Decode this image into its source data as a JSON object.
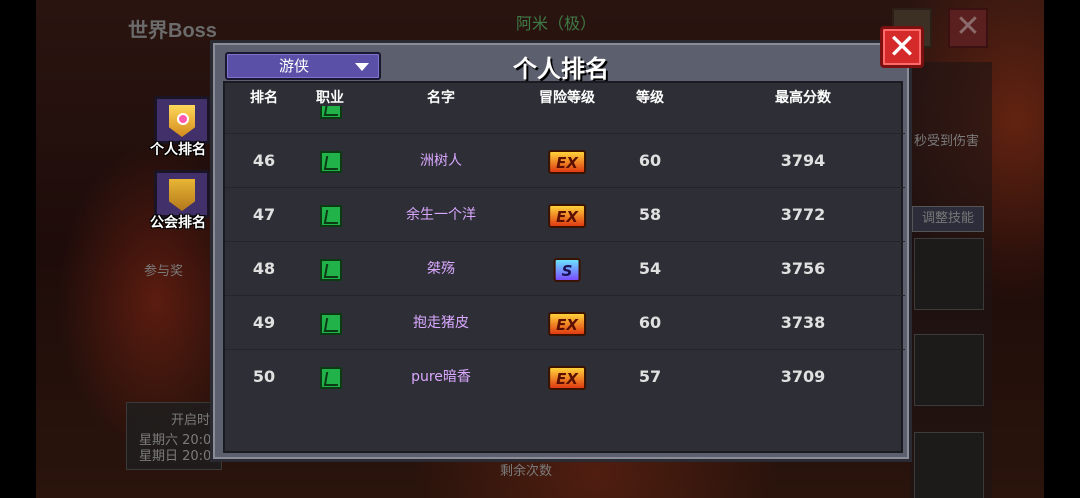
{
  "background": {
    "title": "世界Boss",
    "boss_name": "阿米（极）",
    "close_glyph": "✕",
    "side_damage_text": "秒受到伤害",
    "adjust_skill_label": "调整技能",
    "join_reward_label": "参与奖",
    "open_time_label": "开启时",
    "schedule": [
      "星期六 20:0",
      "星期日 20:0"
    ],
    "remaining_text": "剩余次数"
  },
  "side_tabs": [
    {
      "label": "个人排名",
      "active": true
    },
    {
      "label": "公会排名",
      "active": false
    }
  ],
  "panel": {
    "title": "个人排名",
    "class_filter": "游侠",
    "close_glyph": "✕",
    "columns": [
      "排名",
      "职业",
      "名字",
      "冒险等级",
      "等级",
      "最高分数"
    ]
  },
  "rows": [
    {
      "rank": "46",
      "name": "洲树人",
      "badge": "EX",
      "badge_type": "ex",
      "level": "60",
      "score": "3794"
    },
    {
      "rank": "47",
      "name": "余生一个洋",
      "badge": "EX",
      "badge_type": "ex",
      "level": "58",
      "score": "3772"
    },
    {
      "rank": "48",
      "name": "桀殇",
      "badge": "S",
      "badge_type": "s",
      "level": "54",
      "score": "3756"
    },
    {
      "rank": "49",
      "name": "抱走猪皮",
      "badge": "EX",
      "badge_type": "ex",
      "level": "60",
      "score": "3738"
    },
    {
      "rank": "50",
      "name": "pure暗香",
      "badge": "EX",
      "badge_type": "ex",
      "level": "57",
      "score": "3709"
    }
  ],
  "colors": {
    "panel_bg": "#5c5f6d",
    "list_bg": "#2e2f36",
    "name_color": "#d9a7ff",
    "dropdown_bg": "#5a50a8",
    "close_red": "#d42a2a"
  }
}
